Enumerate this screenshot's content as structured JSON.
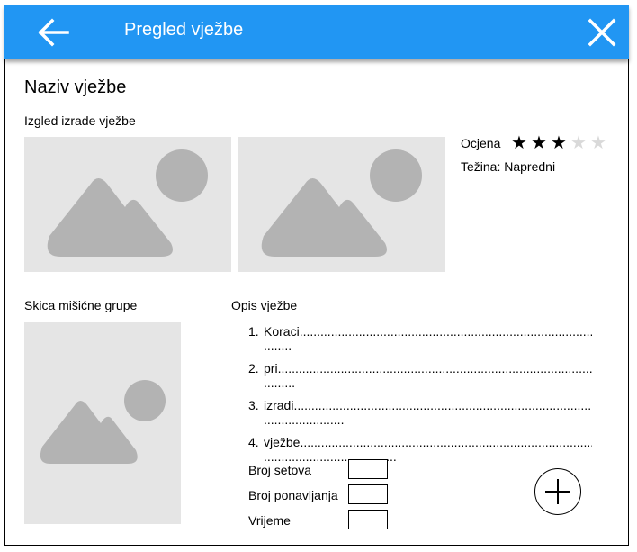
{
  "appbar": {
    "title": "Pregled vježbe",
    "back_icon": "arrow-left-icon",
    "close_icon": "close-icon",
    "color": "#2196f3"
  },
  "exercise": {
    "name": "Naziv vježbe",
    "images_label": "Izgled izrade vježbe",
    "rating_label": "Ocjena",
    "rating": 3,
    "rating_max": 5,
    "difficulty_label": "Težina: Napredni",
    "muscle_label": "Skica mišićne grupe",
    "description_label": "Opis vježbe"
  },
  "steps": [
    {
      "num": "1.",
      "text": "Koraci",
      "cont": "........"
    },
    {
      "num": "2.",
      "text": "pri",
      "cont": "........."
    },
    {
      "num": "3.",
      "text": "izradi",
      "cont": "......................."
    },
    {
      "num": "4.",
      "text": "vježbe",
      "cont": "......................................"
    }
  ],
  "fields": {
    "sets_label": "Broj setova",
    "reps_label": "Broj ponavljanja",
    "time_label": "Vrijeme",
    "sets_value": "",
    "reps_value": "",
    "time_value": ""
  },
  "add_icon": "plus-icon"
}
